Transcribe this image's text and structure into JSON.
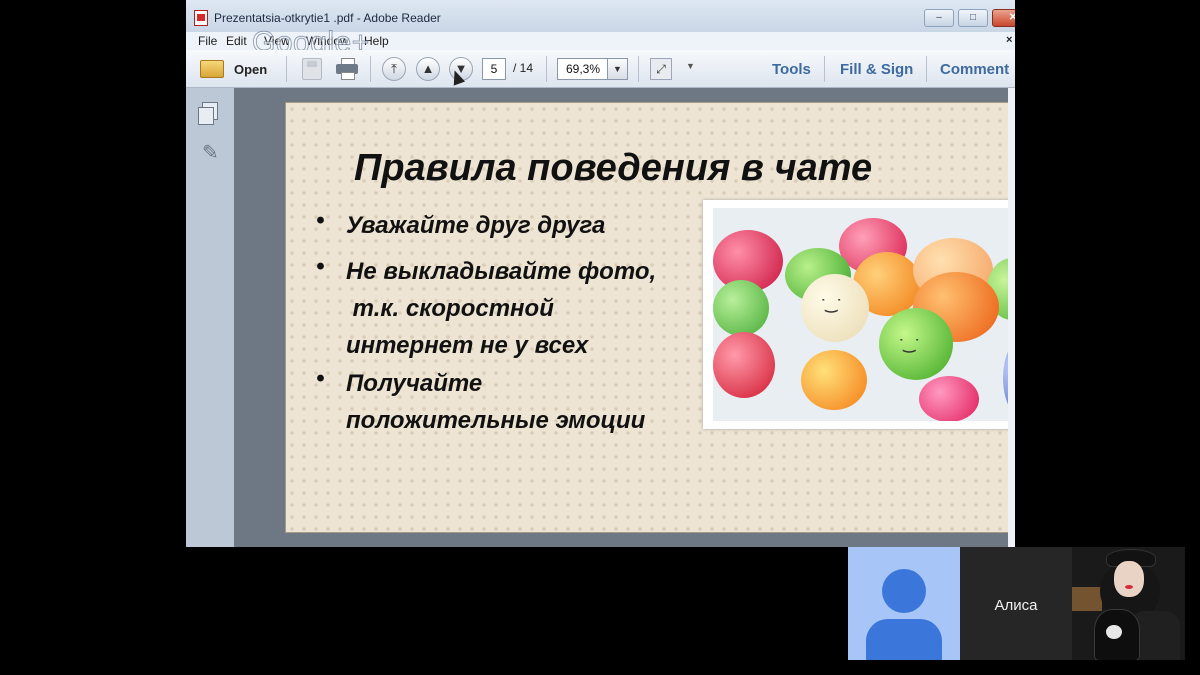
{
  "window": {
    "title": "Prezentatsia-otkrytie1 .pdf - Adobe Reader",
    "controls": [
      "–",
      "□",
      "✕"
    ]
  },
  "menu": [
    "File",
    "Edit",
    "View",
    "Window",
    "Help"
  ],
  "watermark": "Google+",
  "toolbar": {
    "open_label": "Open",
    "current_page": "5",
    "page_total": "/ 14",
    "zoom": "69,3%",
    "tabs": [
      "Tools",
      "Fill & Sign",
      "Comment"
    ]
  },
  "slide": {
    "title": "Правила поведения в чате",
    "bullets": [
      {
        "lines": [
          "Уважайте друг друга"
        ]
      },
      {
        "lines": [
          "Не выкладывайте фото,",
          " т.к. скоростной",
          "интернет не у всех"
        ]
      },
      {
        "lines": [
          "Получайте",
          "положительные эмоции"
        ]
      }
    ],
    "bullet_char": "•"
  },
  "call": {
    "participant_name": "Алиса"
  },
  "colors": {
    "tab_link": "#3e6aa0",
    "avatar_bg": "#a7c5f7",
    "avatar_fg": "#3b77db"
  },
  "icons": [
    "pdf-file-icon",
    "folder-icon",
    "save-icon",
    "print-icon",
    "first-page-icon",
    "previous-page-icon",
    "next-page-icon",
    "fit-page-icon",
    "pages-panel-icon",
    "attachment-icon",
    "avatar-icon"
  ]
}
